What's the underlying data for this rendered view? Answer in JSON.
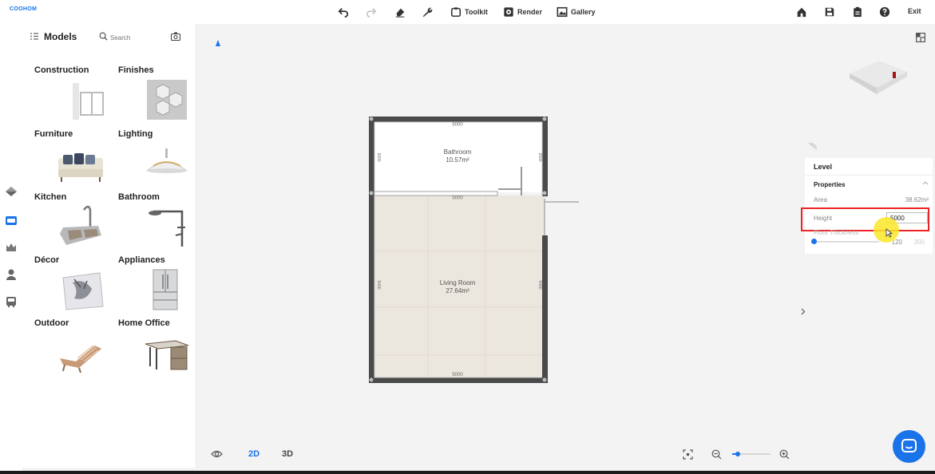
{
  "app": {
    "logo": "COOHOM"
  },
  "toolbar": {
    "toolkit_label": "Toolkit",
    "render_label": "Render",
    "gallery_label": "Gallery",
    "exit_label": "Exit"
  },
  "models": {
    "title": "Models",
    "search_placeholder": "Search",
    "categories": [
      {
        "label": "Construction",
        "icon": "door-window-thumb"
      },
      {
        "label": "Finishes",
        "icon": "tile-thumb"
      },
      {
        "label": "Furniture",
        "icon": "sofa-thumb"
      },
      {
        "label": "Lighting",
        "icon": "pendant-lamp-thumb"
      },
      {
        "label": "Kitchen",
        "icon": "sink-thumb"
      },
      {
        "label": "Bathroom",
        "icon": "shower-thumb"
      },
      {
        "label": "Décor",
        "icon": "pillow-thumb"
      },
      {
        "label": "Appliances",
        "icon": "fridge-thumb"
      },
      {
        "label": "Outdoor",
        "icon": "lounger-thumb"
      },
      {
        "label": "Home Office",
        "icon": "desk-thumb"
      }
    ]
  },
  "floorplan": {
    "rooms": [
      {
        "name": "Bathroom",
        "area": "10.57m²"
      },
      {
        "name": "Living Room",
        "area": "27.64m²"
      }
    ],
    "dimensions": {
      "top": "5000",
      "middle": "5000",
      "bottom": "5000",
      "bath_left": "2000",
      "bath_right": "2000",
      "living_left": "5400",
      "living_right": "5400"
    }
  },
  "view": {
    "mode_2d": "2D",
    "mode_3d": "3D",
    "active": "2D",
    "zoom_fraction": 0.15
  },
  "properties": {
    "level_title": "Level",
    "section_title": "Properties",
    "area_label": "Area",
    "area_value": "38.62m²",
    "height_label": "Height",
    "height_value": "5000",
    "floor_thickness_label": "Floor Thickness",
    "floor_thickness_value": "120",
    "floor_thickness_max": "300"
  },
  "colors": {
    "accent": "#1a73e8",
    "highlight_box": "#e22222",
    "floor": "#ebe6de",
    "wall": "#4a4a4a"
  }
}
